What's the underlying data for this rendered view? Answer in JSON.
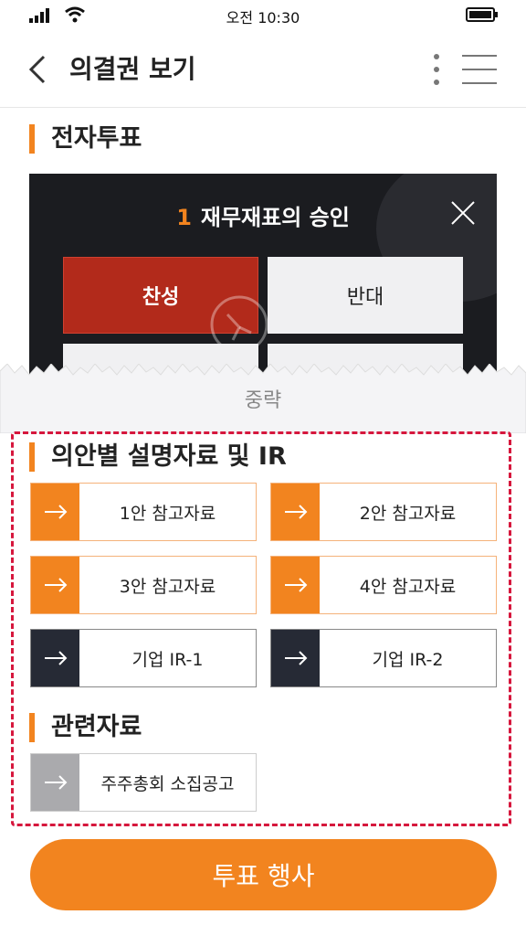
{
  "status_bar": {
    "time": "오전 10:30"
  },
  "header": {
    "title": "의결권 보기"
  },
  "evote": {
    "section_title": "전자투표",
    "item_number": "1",
    "item_title": "재무재표의 승인",
    "approve_label": "찬성",
    "oppose_label": "반대"
  },
  "omitted_label": "중략",
  "materials": {
    "section_title": "의안별 설명자료 및 IR",
    "items": [
      {
        "label": "1안 참고자료"
      },
      {
        "label": "2안 참고자료"
      },
      {
        "label": "3안 참고자료"
      },
      {
        "label": "4안 참고자료"
      },
      {
        "label": "기업 IR-1"
      },
      {
        "label": "기업 IR-2"
      }
    ]
  },
  "related": {
    "section_title": "관련자료",
    "items": [
      {
        "label": "주주총회 소집공고"
      }
    ]
  },
  "action": {
    "vote_label": "투표 행사"
  },
  "colors": {
    "accent": "#f2841f",
    "approve": "#b22a1b",
    "dark": "#262a35",
    "highlight": "#d6173d"
  },
  "icons": [
    "signal-icon",
    "wifi-icon",
    "battery-icon",
    "back-icon",
    "more-icon",
    "menu-icon",
    "close-icon",
    "arrow-right-icon",
    "stamp-icon"
  ]
}
